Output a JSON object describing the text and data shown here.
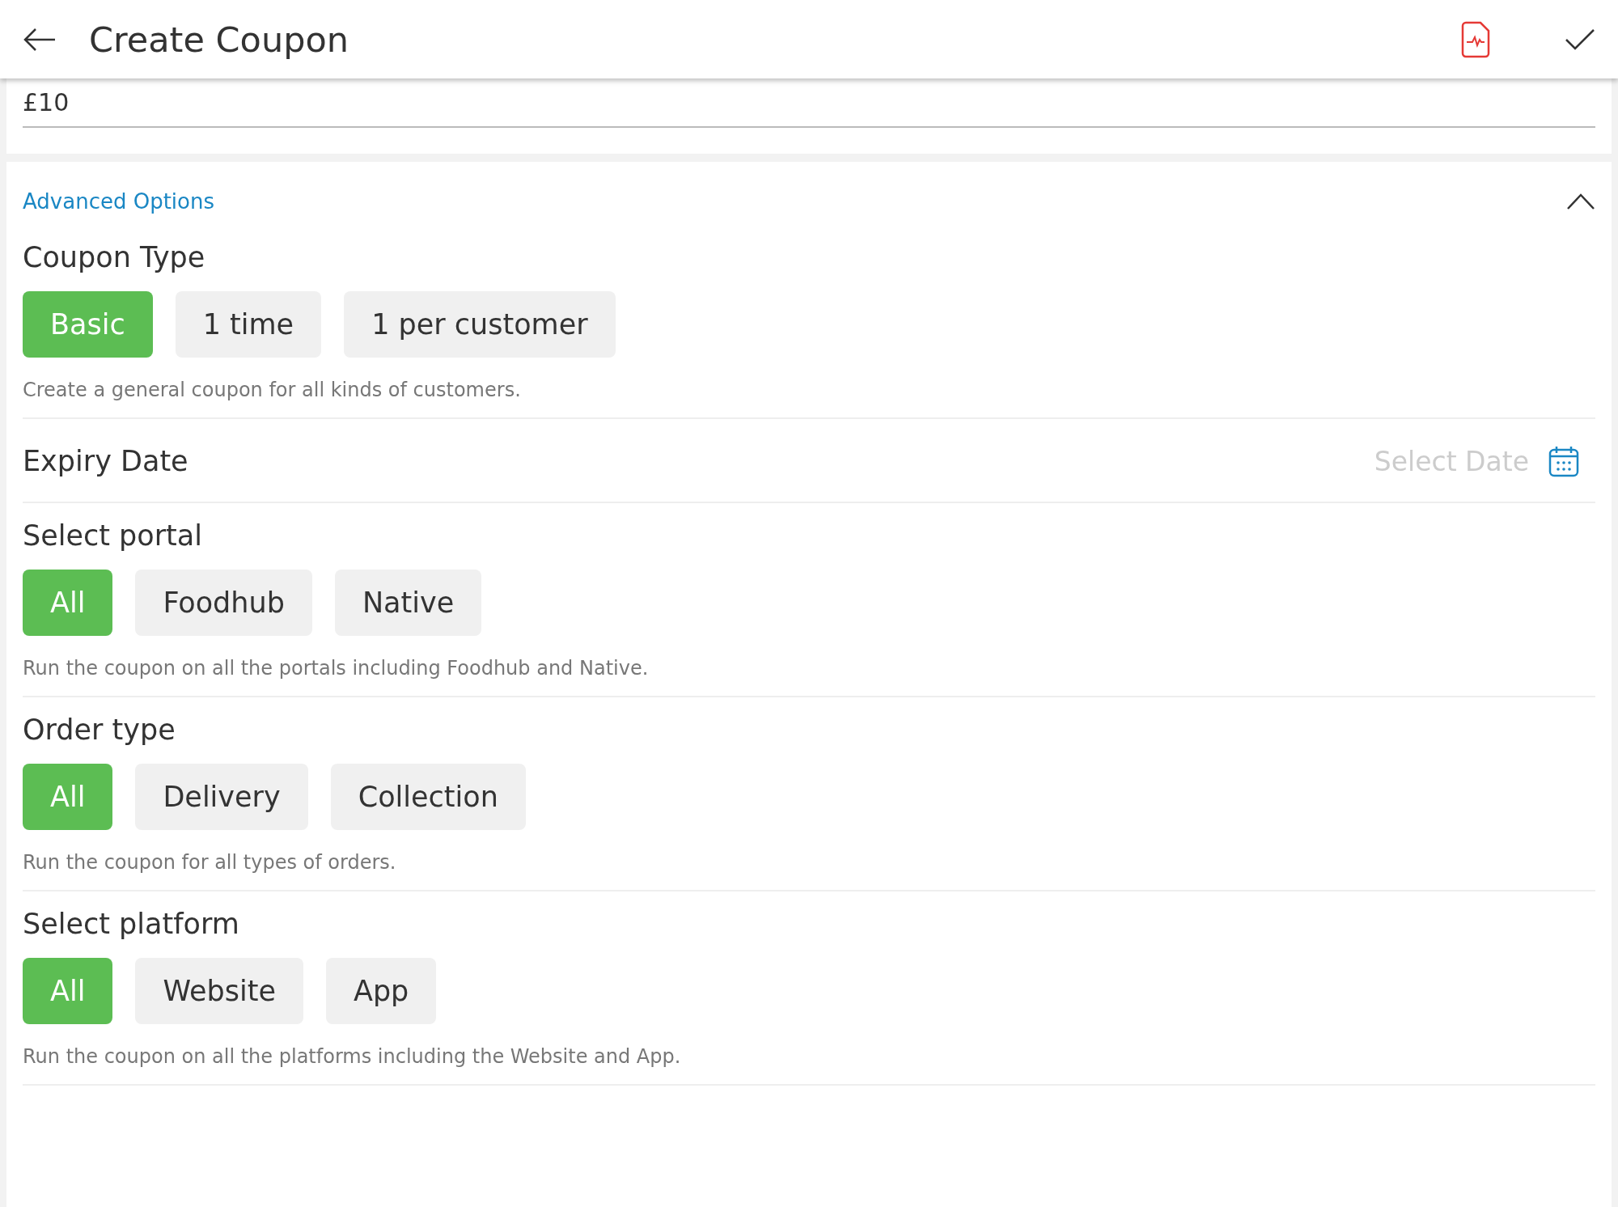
{
  "header": {
    "title": "Create Coupon"
  },
  "amount_field": {
    "value": "£10"
  },
  "advanced_options": {
    "label": "Advanced Options",
    "expanded": true
  },
  "sections": [
    {
      "kind": "options",
      "title": "Coupon Type",
      "options": [
        {
          "label": "Basic",
          "selected": true
        },
        {
          "label": "1 time",
          "selected": false
        },
        {
          "label": "1 per customer",
          "selected": false
        }
      ],
      "description": "Create a general coupon for all kinds of customers."
    },
    {
      "kind": "date",
      "title": "Expiry Date",
      "placeholder": "Select Date"
    },
    {
      "kind": "options",
      "title": "Select portal",
      "options": [
        {
          "label": "All",
          "selected": true
        },
        {
          "label": "Foodhub",
          "selected": false
        },
        {
          "label": "Native",
          "selected": false
        }
      ],
      "description": "Run the coupon on all the portals including Foodhub and Native."
    },
    {
      "kind": "options",
      "title": "Order type",
      "options": [
        {
          "label": "All",
          "selected": true
        },
        {
          "label": "Delivery",
          "selected": false
        },
        {
          "label": "Collection",
          "selected": false
        }
      ],
      "description": "Run the coupon for all types of orders."
    },
    {
      "kind": "options",
      "title": "Select platform",
      "options": [
        {
          "label": "All",
          "selected": true
        },
        {
          "label": "Website",
          "selected": false
        },
        {
          "label": "App",
          "selected": false
        }
      ],
      "description": "Run the coupon on all the platforms including the Website and App."
    }
  ]
}
